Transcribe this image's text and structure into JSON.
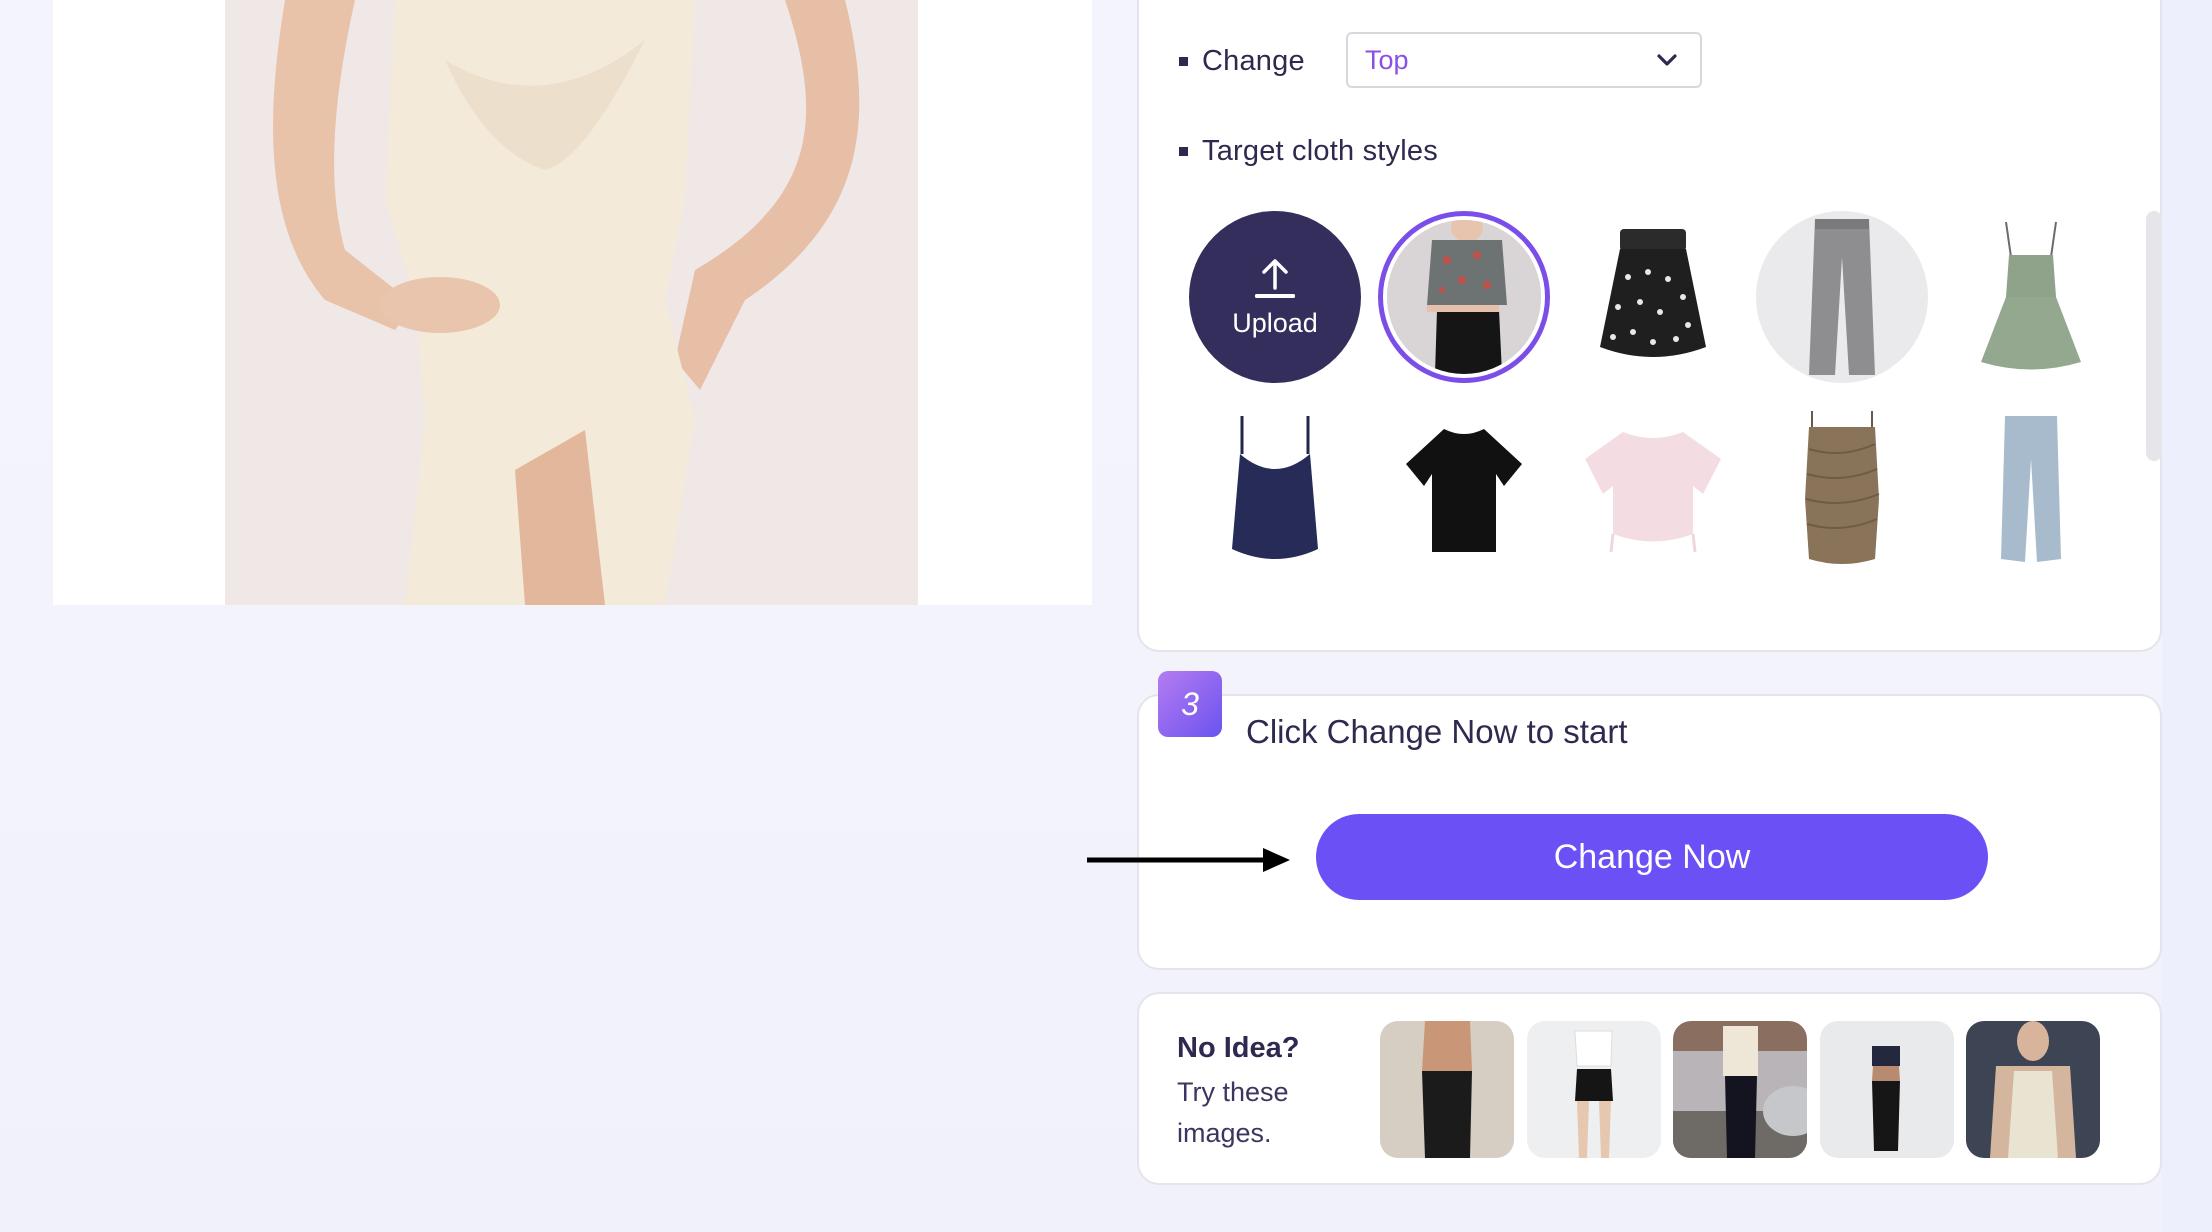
{
  "preview": {
    "alt": "Model wearing cream cowl-neck slip dress"
  },
  "change": {
    "label": "Change",
    "selected": "Top"
  },
  "target_styles": {
    "label": "Target cloth styles",
    "upload_label": "Upload",
    "items": [
      {
        "name": "floral-crop-top-with-black-pants",
        "selected": true
      },
      {
        "name": "black-floral-skirt"
      },
      {
        "name": "grey-wide-leg-jeans"
      },
      {
        "name": "green-ruched-sundress"
      },
      {
        "name": "navy-camisole"
      },
      {
        "name": "black-tshirt"
      },
      {
        "name": "pink-drawstring-tee"
      },
      {
        "name": "brown-ruched-dress"
      },
      {
        "name": "light-blue-jeans"
      }
    ]
  },
  "step3": {
    "number": "3",
    "title": "Click Change Now to start",
    "button_label": "Change Now"
  },
  "no_idea": {
    "title": "No Idea?",
    "subtitle": "Try these images.",
    "samples": [
      "shirtless-man-black-jeans",
      "woman-white-tee-black-shorts",
      "man-cream-shirt-street",
      "woman-sports-bra-leggings",
      "woman-white-halter-top"
    ]
  },
  "colors": {
    "accent": "#6a50f5",
    "selected_ring": "#7c4ee8",
    "dropdown_value": "#8a4fe6",
    "upload_bg": "#342e5c",
    "text_primary": "#2e2a4f"
  }
}
